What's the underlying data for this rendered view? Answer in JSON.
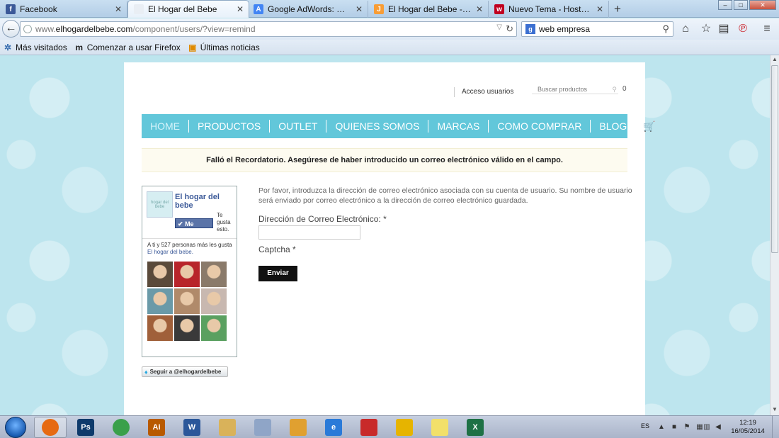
{
  "browser": {
    "tabs": [
      {
        "label": "Facebook",
        "favicon": "f",
        "color": "#3b5998"
      },
      {
        "label": "El Hogar del Bebe",
        "favicon": "",
        "color": "#e9eef4",
        "active": true
      },
      {
        "label": "Google AdWords: Planifica...",
        "favicon": "A",
        "color": "#4285f4"
      },
      {
        "label": "El Hogar del Bebe - Admini...",
        "favicon": "J",
        "color": "#f89d35"
      },
      {
        "label": "Nuevo Tema - Hosting Wo...",
        "favicon": "w",
        "color": "#c00020"
      }
    ],
    "url": {
      "prefix": "www.",
      "domain": "elhogardelbebe.com",
      "path": "/component/users/?view=remind"
    },
    "search": {
      "value": "web empresa",
      "engine_icon": "g"
    },
    "bookmarks": [
      {
        "label": "Más visitados",
        "icon": "gear-icon"
      },
      {
        "label": "Comenzar a usar Firefox",
        "icon": "m-logo-icon"
      },
      {
        "label": "Últimas noticias",
        "icon": "rss-icon"
      }
    ]
  },
  "site": {
    "access_link": "Acceso usuarios",
    "product_search_placeholder": "Buscar productos",
    "cart_count": "0",
    "menu": [
      "HOME",
      "PRODUCTOS",
      "OUTLET",
      "QUIENES SOMOS",
      "MARCAS",
      "COMO COMPRAR",
      "BLOG"
    ],
    "alert": "Falló el Recordatorio. Asegúrese de haber introducido un correo electrónico válido en el campo.",
    "intro": "Por favor, introduzca la dirección de correo electrónico asociada con su cuenta de usuario. Su nombre de usuario será enviado por correo electrónico a la dirección de correo electrónico guardada.",
    "email_label": "Dirección de Correo Electrónico: *",
    "email_value": "",
    "captcha_label": "Captcha *",
    "submit_label": "Enviar"
  },
  "facebook_box": {
    "page_name": "El hogar del bebe",
    "logo_text": "hogar del bebe",
    "like_label": "Me gusta",
    "like_side_text": "Te gusta esto.",
    "friends_text": "A ti y 527 personas más les gusta",
    "friends_link": "El hogar del bebe.",
    "face_colors": [
      "#5a4a3a",
      "#b8252a",
      "#8a7a6a",
      "#6a9aa8",
      "#b08a6a",
      "#c8b8b0",
      "#a0603a",
      "#3a3a3a",
      "#5aa060"
    ]
  },
  "twitter_button": "Seguir a @elhogardelbebe",
  "taskbar": {
    "apps": [
      {
        "name": "firefox",
        "label": "",
        "color": "#e66a12",
        "active": true
      },
      {
        "name": "photoshop",
        "label": "Ps",
        "color": "#0e3a6b"
      },
      {
        "name": "chrome",
        "label": "",
        "color": "#3aa04a"
      },
      {
        "name": "illustrator",
        "label": "Ai",
        "color": "#b85a00"
      },
      {
        "name": "word",
        "label": "W",
        "color": "#2b579a"
      },
      {
        "name": "explorer",
        "label": "",
        "color": "#d9b25a"
      },
      {
        "name": "calculator",
        "label": "",
        "color": "#8fa5c7"
      },
      {
        "name": "media-player",
        "label": "",
        "color": "#e0a030"
      },
      {
        "name": "internet-explorer",
        "label": "e",
        "color": "#2a7ad8"
      },
      {
        "name": "filezilla",
        "label": "",
        "color": "#c82a2a"
      },
      {
        "name": "outlook",
        "label": "",
        "color": "#e6b400"
      },
      {
        "name": "sticky-notes",
        "label": "",
        "color": "#f2e06a"
      },
      {
        "name": "excel",
        "label": "X",
        "color": "#1e7145"
      }
    ],
    "language": "ES",
    "time": "12:19",
    "date": "16/05/2014"
  }
}
